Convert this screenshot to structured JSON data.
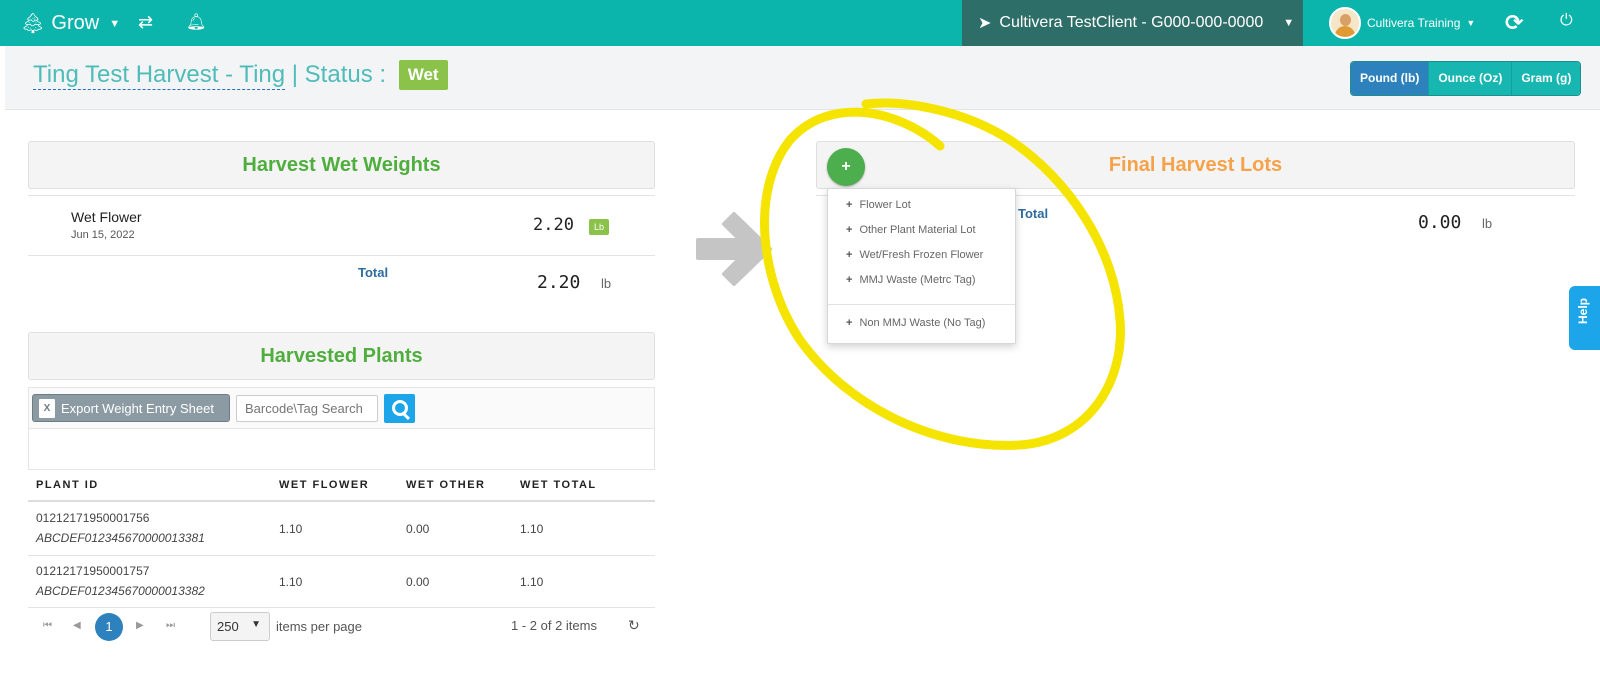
{
  "nav": {
    "app_name": "Grow",
    "brand_icon": "tree-icon",
    "client": "Cultivera TestClient - G000-000-0000",
    "user_name": "Cultivera Training",
    "bg_color": "#0bb5ab"
  },
  "header": {
    "title_harvest": "Ting Test Harvest - Ting",
    "title_sep": " | Status : ",
    "status": "Wet",
    "units": [
      "Pound (lb)",
      "Ounce (Oz)",
      "Gram (g)"
    ],
    "active_unit": "Pound (lb)"
  },
  "wet_weights": {
    "title": "Harvest Wet Weights",
    "row_name": "Wet Flower",
    "row_date": "Jun 15, 2022",
    "row_value": "2.20",
    "row_unit_badge": "Lb",
    "total_label": "Total",
    "total_value": "2.20",
    "total_unit": "lb"
  },
  "harvested_plants": {
    "title": "Harvested Plants",
    "export_label": "Export Weight Entry Sheet",
    "search_placeholder": "Barcode\\Tag Search",
    "columns": [
      "PLANT ID",
      "WET FLOWER",
      "WET OTHER",
      "WET TOTAL"
    ],
    "rows": [
      {
        "id": "01212171950001756",
        "tag": "ABCDEF012345670000013381",
        "flower": "1.10",
        "other": "0.00",
        "total": "1.10"
      },
      {
        "id": "01212171950001757",
        "tag": "ABCDEF012345670000013382",
        "flower": "1.10",
        "other": "0.00",
        "total": "1.10"
      }
    ],
    "pager": {
      "page": "1",
      "page_size": "250",
      "items_label": "items per page",
      "summary": "1 - 2 of 2 items"
    }
  },
  "final_lots": {
    "title": "Final Harvest Lots",
    "total_label": "Total",
    "total_value": "0.00",
    "total_unit": "lb",
    "add_button": "+",
    "menu": [
      "Flower Lot",
      "Other Plant Material Lot",
      "Wet/Fresh Frozen Flower",
      "MMJ Waste (Metrc Tag)",
      "Non MMJ Waste (No Tag)"
    ]
  },
  "help": "Help"
}
